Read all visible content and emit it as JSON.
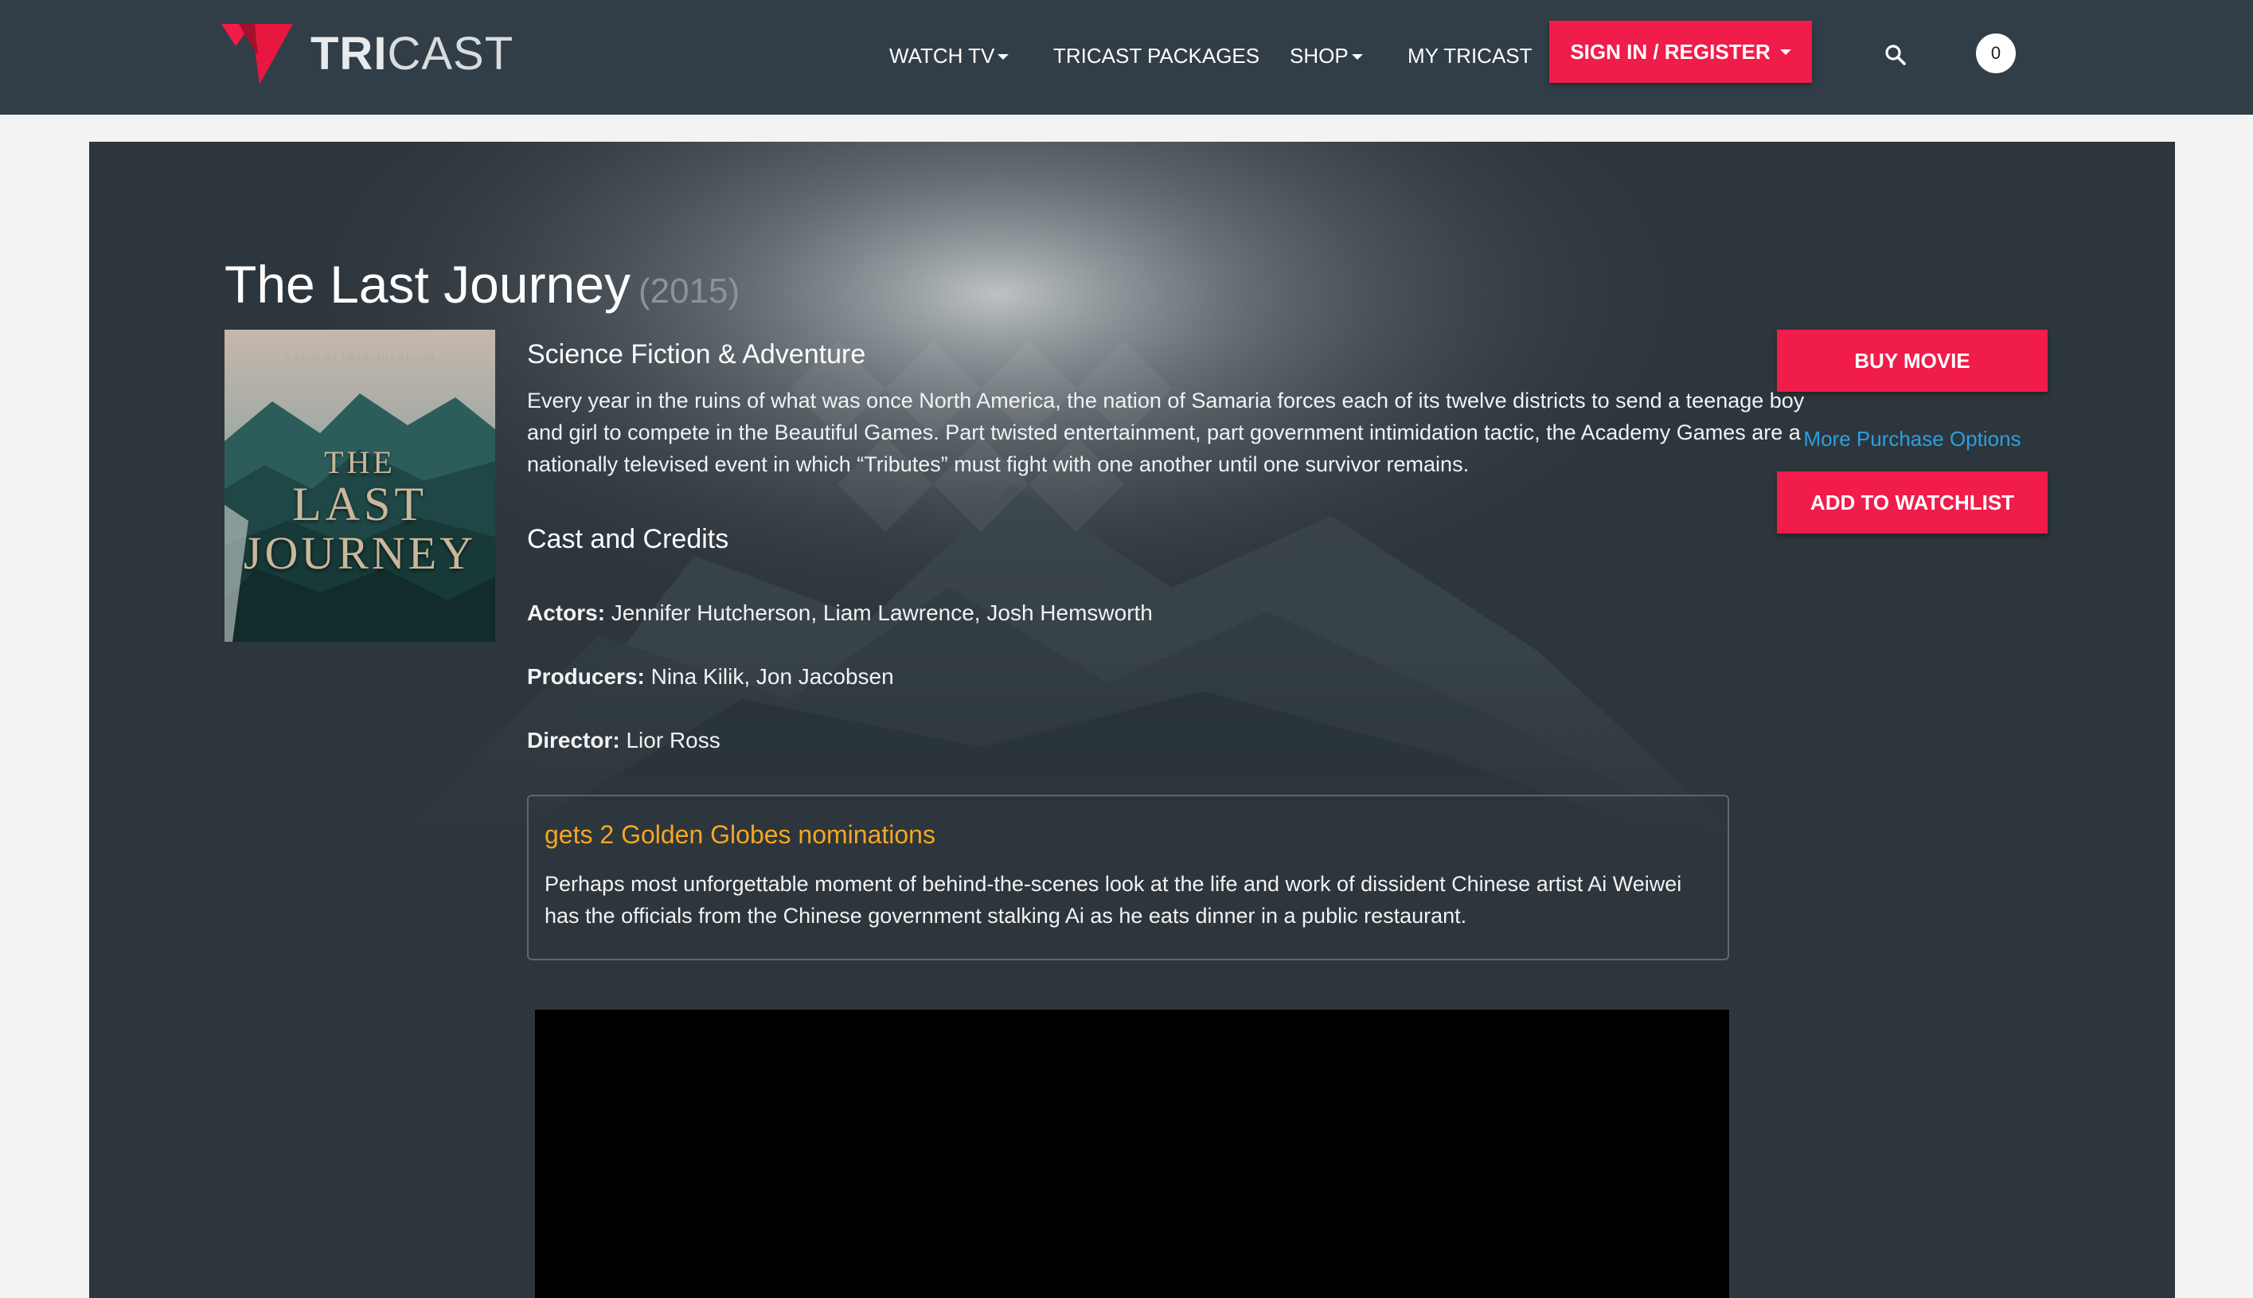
{
  "brand": {
    "prefix": "TRI",
    "suffix": "CAST"
  },
  "nav": {
    "items": [
      {
        "label": "WATCH TV",
        "dropdown": true
      },
      {
        "label": "TRICAST PACKAGES",
        "dropdown": false
      },
      {
        "label": "SHOP",
        "dropdown": true
      },
      {
        "label": "MY TRICAST",
        "dropdown": false
      }
    ],
    "signin_label": "SIGN IN / REGISTER",
    "cart_count": "0"
  },
  "movie": {
    "title": "The Last Journey",
    "year": "(2015)",
    "genre": "Science Fiction & Adventure",
    "description": "Every year in the ruins of what was once North America, the nation of Samaria forces each of its twelve districts to send a teenage boy and girl to compete in the Beautiful Games. Part twisted entertainment, part government intimidation tactic, the Academy Games are a nationally televised event in which “Tributes” must fight with one another until one survivor remains.",
    "poster": {
      "credit": "A FILM BY FRANCOIS REGON",
      "line1": "THE",
      "line2": "LAST",
      "line3": "JOURNEY"
    },
    "cast_heading": "Cast and Credits",
    "actors_label": "Actors:",
    "actors": "Jennifer Hutcherson, Liam Lawrence, Josh Hemsworth",
    "producers_label": "Producers:",
    "producers": "Nina Kilik, Jon Jacobsen",
    "director_label": "Director:",
    "director": "Lior Ross"
  },
  "note": {
    "title": "gets 2 Golden Globes nominations",
    "body": "Perhaps most unforgettable moment of behind-the-scenes look at the life and work of dissident Chinese artist Ai Weiwei has the officials from the Chinese government stalking Ai as he eats dinner in a public restaurant."
  },
  "actions": {
    "buy_label": "BUY MOVIE",
    "more_label": "More Purchase Options",
    "watchlist_label": "ADD TO WATCHLIST"
  },
  "colors": {
    "header_bg": "#323e47",
    "panel_bg": "#2d363c",
    "accent": "#f01c4a",
    "link": "#2b9fe0",
    "note_title": "#f5a623"
  }
}
